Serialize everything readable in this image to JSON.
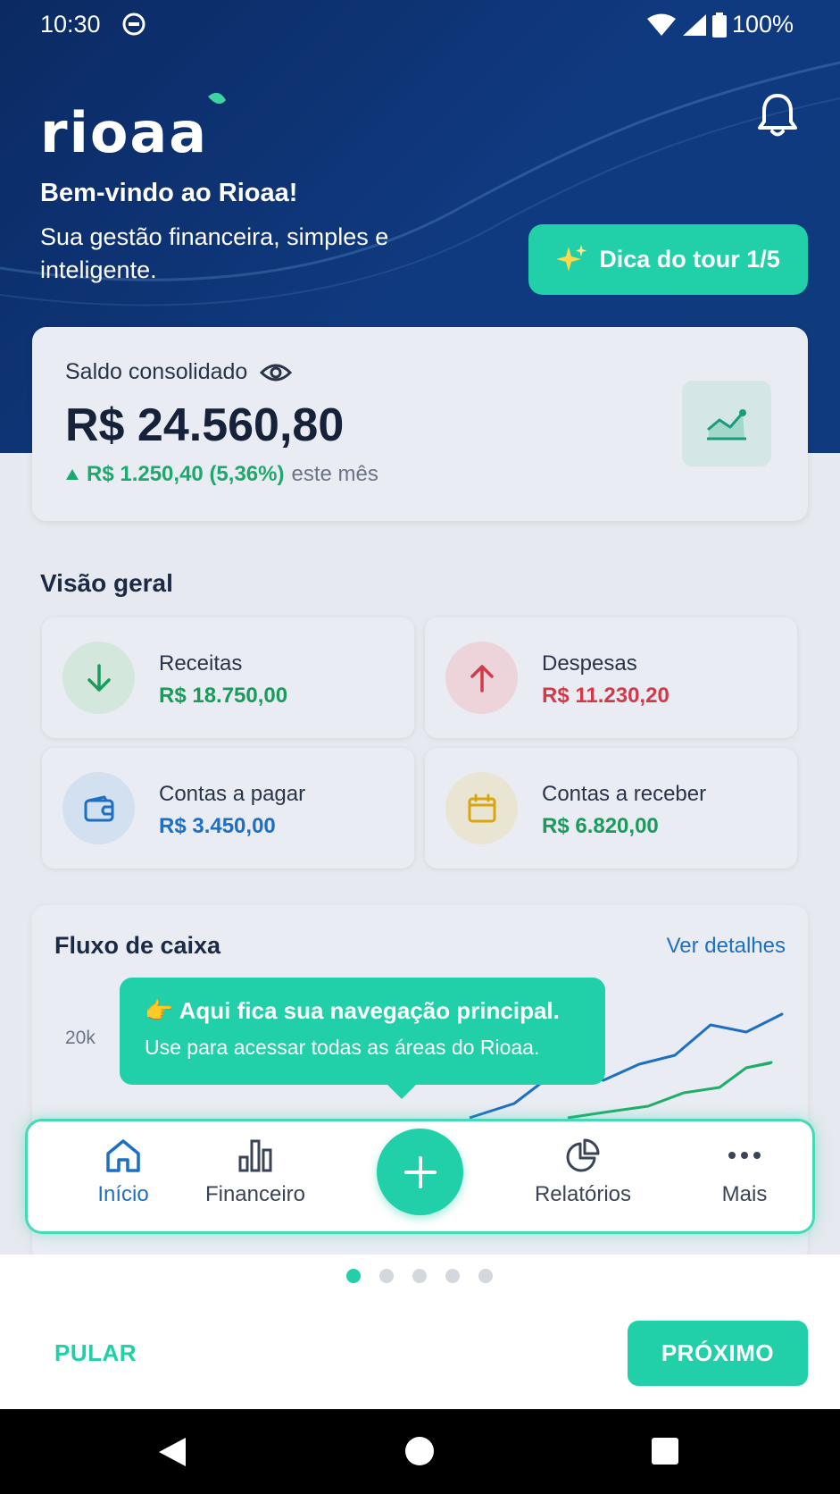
{
  "status_bar": {
    "time": "10:30",
    "battery": "100%"
  },
  "header": {
    "logo_text": "rioaa",
    "title": "Bem-vindo ao Rioaa!",
    "subtitle": "Sua gestão financeira, simples e inteligente.",
    "tour_button": "Dica do tour 1/5",
    "icons": [
      "sparkles-icon",
      "bell-icon"
    ]
  },
  "balance": {
    "label": "Saldo consolidado",
    "value": "R$ 24.560,80",
    "change": "R$ 1.250,40 (5,36%)",
    "change_suffix": "este mês"
  },
  "overview": {
    "title": "Visão geral",
    "tiles": [
      {
        "label": "Receitas",
        "value": "R$ 18.750,00",
        "color": "#1a9b5b",
        "icon": "arrow-down-icon"
      },
      {
        "label": "Despesas",
        "value": "R$ 11.230,20",
        "color": "#d23a4a",
        "icon": "arrow-up-icon"
      },
      {
        "label": "Contas a pagar",
        "value": "R$ 3.450,00",
        "color": "#1d6fc4",
        "icon": "wallet-icon"
      },
      {
        "label": "Contas a receber",
        "value": "R$ 6.820,00",
        "color": "#1a9b5b",
        "icon": "calendar-icon"
      }
    ]
  },
  "cashflow": {
    "title": "Fluxo de caixa",
    "link": "Ver detalhes",
    "axis_label": "20k"
  },
  "tooltip": {
    "line1": "👉 Aqui fica sua navegação principal.",
    "line2": "Use para acessar todas as áreas do Rioaa."
  },
  "navbar": {
    "items": [
      {
        "label": "Início",
        "icon": "home-icon",
        "active": true
      },
      {
        "label": "Financeiro",
        "icon": "bar-chart-icon",
        "active": false
      },
      {
        "label": "Relatórios",
        "icon": "pie-chart-icon",
        "active": false
      },
      {
        "label": "Mais",
        "icon": "more-icon",
        "active": false
      }
    ],
    "fab_icon": "plus-icon"
  },
  "onboarding": {
    "pages": 5,
    "current_page": 1,
    "skip": "PULAR",
    "next": "PRÓXIMO"
  },
  "colors": {
    "accent": "#21cfa8",
    "header": "#0f3a7d",
    "link": "#1d6fc4"
  }
}
